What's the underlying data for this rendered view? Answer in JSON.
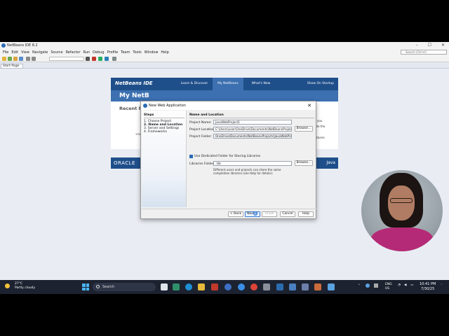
{
  "window": {
    "title": "NetBeans IDE 8.2",
    "search_placeholder": "Search (Ctrl+I)",
    "minimize": "–",
    "maximize": "☐",
    "close": "✕"
  },
  "menu": [
    "File",
    "Edit",
    "View",
    "Navigate",
    "Source",
    "Refactor",
    "Run",
    "Debug",
    "Profile",
    "Team",
    "Tools",
    "Window",
    "Help"
  ],
  "editor_tab": "Start Page",
  "start_page": {
    "logo": "NetBeans IDE",
    "tabs": [
      "Learn & Discover",
      "My NetBeans",
      "What's New"
    ],
    "show_on_startup": "Show On Startup",
    "heading": "My NetB",
    "recent": "Recent P",
    "side_text_left": "<no",
    "side_text_right_1": "you",
    "side_text_right_2": "ude the",
    "side_text_right_3": "atures",
    "oracle": "ORACLE",
    "java": "Java"
  },
  "dialog": {
    "title": "New Web Application",
    "close": "✕",
    "steps_title": "Steps",
    "steps": [
      {
        "num": "1.",
        "label": "Choose Project"
      },
      {
        "num": "2.",
        "label": "Name and Location"
      },
      {
        "num": "3.",
        "label": "Server and Settings"
      },
      {
        "num": "4.",
        "label": "Frameworks"
      }
    ],
    "section_title": "Name and Location",
    "project_name_label": "Project Name:",
    "project_name_value": "JavaWebProject1",
    "project_location_label": "Project Location:",
    "project_location_value": "C:\\Users\\user\\OneDrive\\Documents\\NetBeansProjects",
    "project_folder_label": "Project Folder:",
    "project_folder_value": "OneDrive\\Documents\\NetBeansProjects\\JavaWebProject1",
    "browse": "Browse...",
    "dedicated_folder_label": "Use Dedicated Folder for Storing Libraries",
    "libraries_folder_label": "Libraries Folder:",
    "libraries_folder_value": ".\\lib",
    "note_line1": "Different users and projects can share the same",
    "note_line2": "compilation libraries (see Help for details).",
    "buttons": {
      "back": "< Back",
      "next": "Next >",
      "finish": "Finish",
      "cancel": "Cancel",
      "help": "Help"
    }
  },
  "status": {
    "building": "Building dictionary",
    "progress": 0.55,
    "mode": "INS"
  },
  "taskbar": {
    "temperature": "27°C",
    "weather": "Partly cloudy",
    "search": "Search",
    "lang1": "ENG",
    "lang2": "US",
    "time": "10:41 PM",
    "date": "7/30/25"
  },
  "colors": {
    "netbeans_blue": "#1f4f8a",
    "accent": "#3b7bd6",
    "taskbar": "#1c2230"
  }
}
